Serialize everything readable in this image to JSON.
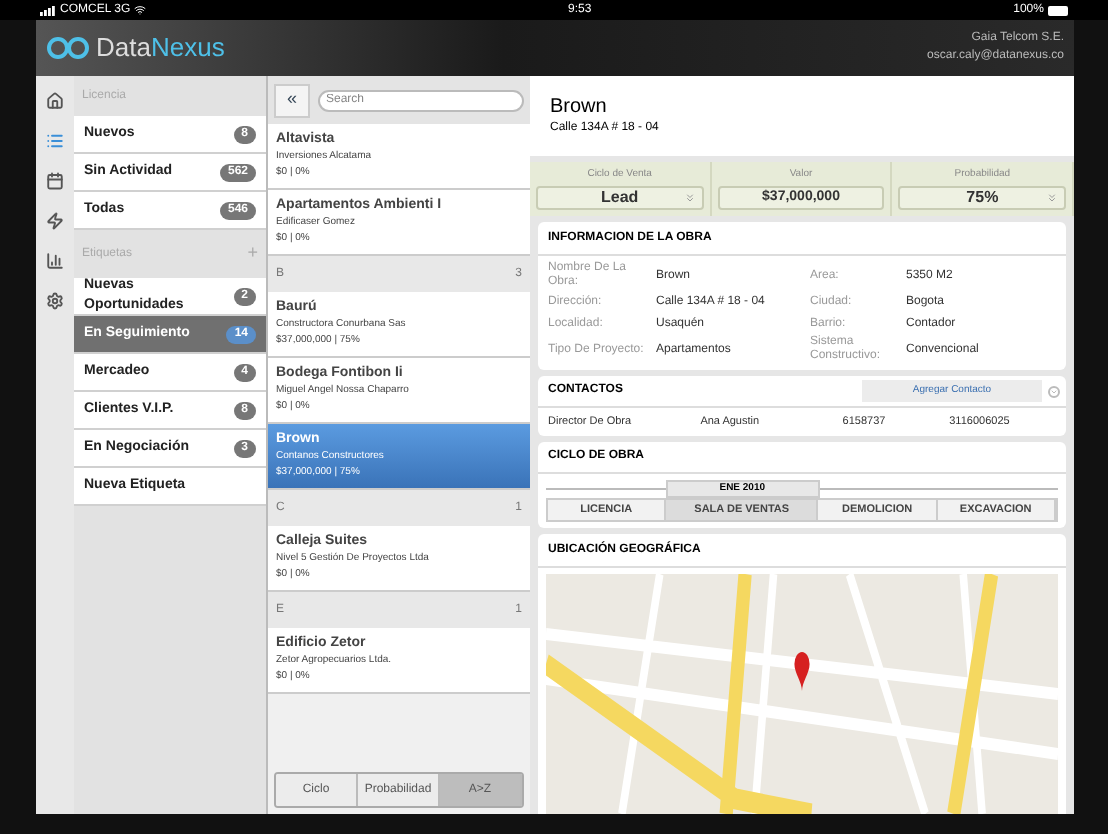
{
  "status_bar": {
    "carrier": "COMCEL 3G",
    "time": "9:53",
    "battery": "100%"
  },
  "header": {
    "logo_prefix": "Data",
    "logo_suffix": "Nexus",
    "company": "Gaia Telcom S.E.",
    "email": "oscar.caly@datanexus.co"
  },
  "nav": [
    {
      "kind": "home",
      "selected": false
    },
    {
      "kind": "list",
      "selected": true
    },
    {
      "kind": "calendar",
      "selected": false
    },
    {
      "kind": "bolt",
      "selected": false
    },
    {
      "kind": "chart",
      "selected": false
    },
    {
      "kind": "settings",
      "selected": false
    }
  ],
  "filters": {
    "licencia_title": "Licencia",
    "licencia_items": [
      {
        "label": "Nuevos",
        "count": "8",
        "selected": false
      },
      {
        "label": "Sin Actividad",
        "count": "562",
        "selected": false
      },
      {
        "label": "Todas",
        "count": "546",
        "selected": false
      }
    ],
    "etiquetas_title": "Etiquetas",
    "add": "+",
    "tags": [
      {
        "label": "Nuevas Oportunidades",
        "count": "2",
        "selected": false
      },
      {
        "label": "En Seguimiento",
        "count": "14",
        "selected": true
      },
      {
        "label": "Mercadeo",
        "count": "4",
        "selected": false
      },
      {
        "label": "Clientes V.I.P.",
        "count": "8",
        "selected": false
      },
      {
        "label": "En Negociación",
        "count": "3",
        "selected": false
      },
      {
        "label": "Nueva Etiqueta",
        "selected": false
      }
    ]
  },
  "list": {
    "back": "«",
    "search_placeholder": "Search",
    "groups": [
      {
        "items": [
          {
            "name": "Altavista",
            "company": "Inversiones Alcatama",
            "meta": "$0 | 0%",
            "selected": false
          },
          {
            "name": "Apartamentos Ambienti I",
            "company": "Edificaser Gomez",
            "meta": "$0 | 0%",
            "selected": false
          }
        ]
      },
      {
        "letter": "B",
        "count": "3",
        "items": [
          {
            "name": "Baurú",
            "company": "Constructora Conurbana Sas",
            "meta": "$37,000,000 | 75%",
            "selected": false
          },
          {
            "name": "Bodega Fontibon Ii",
            "company": "Miguel Angel Nossa Chaparro",
            "meta": "$0 | 0%",
            "selected": false
          },
          {
            "name": "Brown",
            "company": "Contanos Constructores",
            "meta": "$37,000,000 | 75%",
            "selected": true
          }
        ]
      },
      {
        "letter": "C",
        "count": "1",
        "items": [
          {
            "name": "Calleja Suites",
            "company": "Nivel 5 Gestión De Proyectos Ltda",
            "meta": "$0 | 0%",
            "selected": false
          }
        ]
      },
      {
        "letter": "E",
        "count": "1",
        "items": [
          {
            "name": "Edificio Zetor",
            "company": "Zetor Agropecuarios Ltda.",
            "meta": "$0 | 0%",
            "selected": false
          }
        ]
      }
    ],
    "sort_tabs": [
      {
        "label": "Ciclo",
        "selected": false
      },
      {
        "label": "Probabilidad",
        "selected": false
      },
      {
        "label": "A>Z",
        "selected": true
      }
    ]
  },
  "detail": {
    "title": "Brown",
    "address": "Calle 134A # 18 - 04",
    "summary": [
      {
        "label": "Ciclo de Venta",
        "value": "Lead",
        "kind": "dropdown"
      },
      {
        "label": "Valor",
        "value": "$37,000,000",
        "kind": "field"
      },
      {
        "label": "Probabilidad",
        "value": "75%",
        "kind": "dropdown"
      }
    ],
    "info": {
      "title": "INFORMACION DE LA OBRA",
      "rows": [
        [
          {
            "label": "Nombre De La Obra:",
            "value": "Brown"
          },
          {
            "label": "Area:",
            "value": "5350 M2"
          }
        ],
        [
          {
            "label": "Dirección:",
            "value": "Calle 134A # 18 - 04"
          },
          {
            "label": "Ciudad:",
            "value": "Bogota"
          }
        ],
        [
          {
            "label": "Localidad:",
            "value": "Usaquén"
          },
          {
            "label": "Barrio:",
            "value": "Contador"
          }
        ],
        [
          {
            "label": "Tipo De Proyecto:",
            "value": "Apartamentos"
          },
          {
            "label": "Sistema Constructivo:",
            "value": "Convencional"
          }
        ]
      ]
    },
    "contacts": {
      "title": "CONTACTOS",
      "add_button": "Agregar Contacto",
      "rows": [
        [
          "Director De Obra",
          "Ana Agustin",
          "6158737",
          "3116006025"
        ]
      ]
    },
    "cycle": {
      "title": "CICLO DE OBRA",
      "date": "ENE 2010",
      "stages": [
        {
          "label": "LICENCIA",
          "selected": false
        },
        {
          "label": "SALA DE VENTAS",
          "selected": true
        },
        {
          "label": "DEMOLICION",
          "selected": false
        },
        {
          "label": "EXCAVACION",
          "selected": false
        }
      ]
    },
    "map": {
      "title": "UBICACIÓN GEOGRÁFICA"
    }
  }
}
